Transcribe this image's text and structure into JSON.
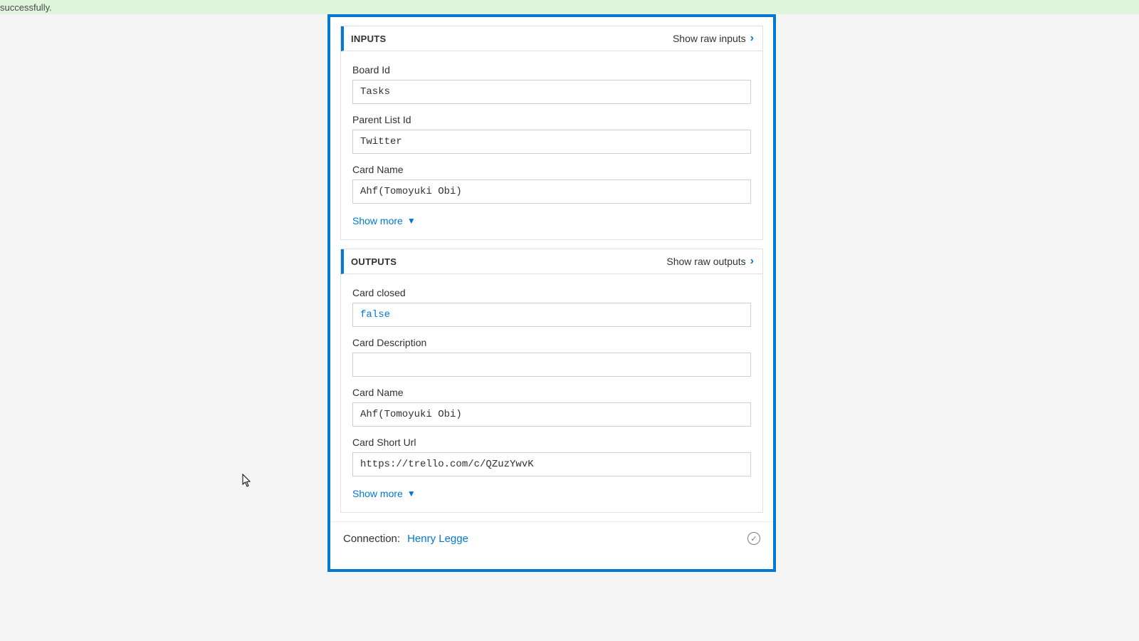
{
  "banner": {
    "text": "successfully."
  },
  "inputs": {
    "title": "INPUTS",
    "show_raw": "Show raw inputs",
    "fields": [
      {
        "label": "Board Id",
        "value": "Tasks"
      },
      {
        "label": "Parent List Id",
        "value": "Twitter"
      },
      {
        "label": "Card Name",
        "value": "Ahf(Tomoyuki Obi)"
      }
    ],
    "show_more": "Show more"
  },
  "outputs": {
    "title": "OUTPUTS",
    "show_raw": "Show raw outputs",
    "fields": [
      {
        "label": "Card closed",
        "value": "false",
        "style": "falsey"
      },
      {
        "label": "Card Description",
        "value": ""
      },
      {
        "label": "Card Name",
        "value": "Ahf(Tomoyuki Obi)"
      },
      {
        "label": "Card Short Url",
        "value": "https://trello.com/c/QZuzYwvK"
      }
    ],
    "show_more": "Show more"
  },
  "connection": {
    "label": "Connection:",
    "name": "Henry Legge"
  }
}
